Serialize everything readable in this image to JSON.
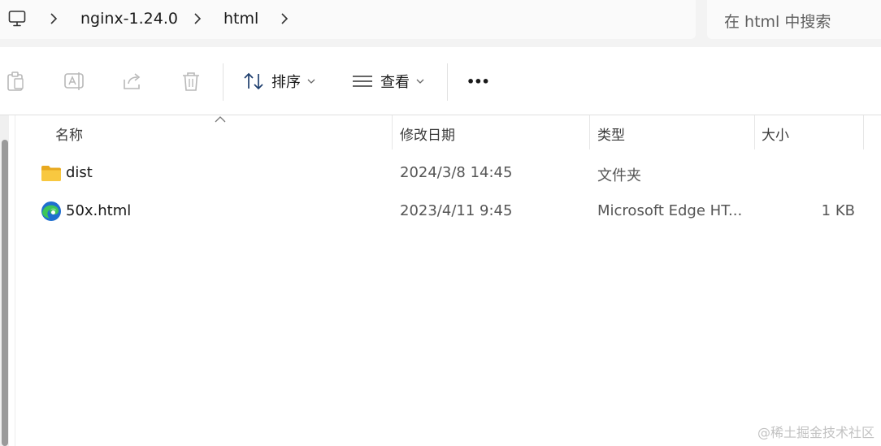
{
  "address": {
    "breadcrumbs": [
      "nginx-1.24.0",
      "html"
    ],
    "search_placeholder": "在 html 中搜索"
  },
  "toolbar": {
    "sort_label": "排序",
    "view_label": "查看",
    "more_label": "•••"
  },
  "columns": {
    "name": "名称",
    "modified": "修改日期",
    "type": "类型",
    "size": "大小"
  },
  "files": [
    {
      "name": "dist",
      "modified": "2024/3/8 14:45",
      "type": "文件夹",
      "size": "",
      "icon": "folder-icon"
    },
    {
      "name": "50x.html",
      "modified": "2023/4/11 9:45",
      "type": "Microsoft Edge HT...",
      "size": "1 KB",
      "icon": "edge-icon"
    }
  ],
  "watermark": "@稀土掘金技术社区",
  "colors": {
    "folder": "#f8c840",
    "edge_blue": "#1f6fd0",
    "edge_green": "#3cc55a"
  }
}
